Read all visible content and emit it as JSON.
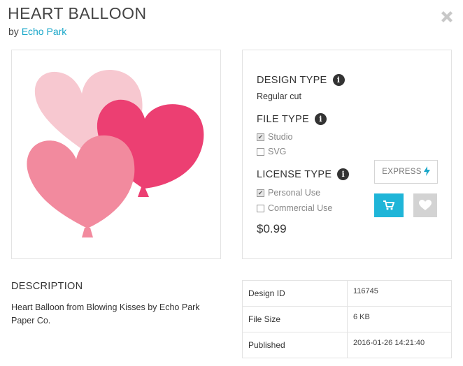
{
  "header": {
    "title": "HEART BALLOON",
    "by_prefix": "by",
    "author": "Echo Park"
  },
  "info": {
    "design_type_label": "DESIGN TYPE",
    "design_type_value": "Regular cut",
    "file_type_label": "FILE TYPE",
    "file_types": [
      {
        "label": "Studio",
        "checked": true
      },
      {
        "label": "SVG",
        "checked": false
      }
    ],
    "license_type_label": "LICENSE TYPE",
    "license_types": [
      {
        "label": "Personal Use",
        "checked": true
      },
      {
        "label": "Commercial Use",
        "checked": false
      }
    ],
    "price": "$0.99",
    "express_label": "EXPRESS"
  },
  "description": {
    "heading": "DESCRIPTION",
    "text": "Heart Balloon from Blowing Kisses by Echo Park Paper Co."
  },
  "details": [
    {
      "key": "Design ID",
      "value": "116745"
    },
    {
      "key": "File Size",
      "value": "6 KB"
    },
    {
      "key": "Published",
      "value": "2016-01-26 14:21:40"
    }
  ],
  "colors": {
    "accent": "#1fb5d8",
    "link": "#1aa7c9",
    "balloon_light": "#f7c8d0",
    "balloon_magenta": "#ec3f72",
    "balloon_pink": "#f28a9e"
  },
  "icons": {
    "close": "close-icon",
    "info": "info-icon",
    "cart": "cart-icon",
    "heart": "heart-icon",
    "bolt": "bolt-icon"
  }
}
